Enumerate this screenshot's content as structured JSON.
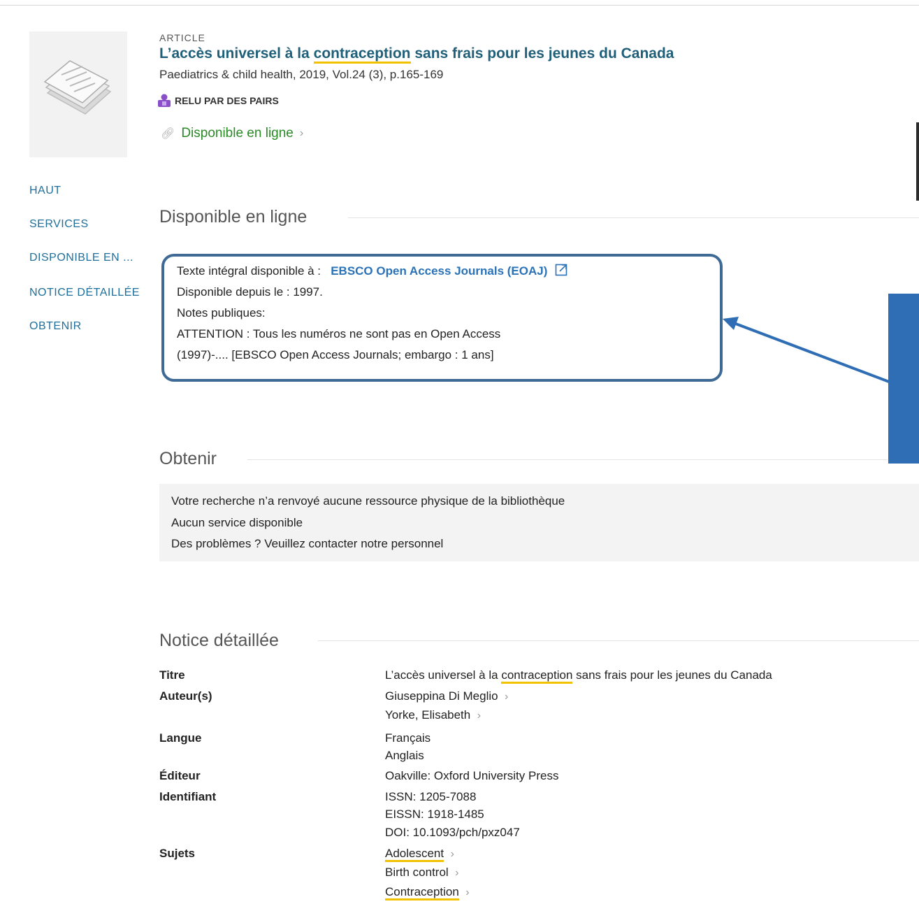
{
  "record": {
    "type": "ARTICLE",
    "title_before": "L’accès universel à la ",
    "title_highlight": "contraception",
    "title_after": " sans frais pour les jeunes du Canada",
    "source": "Paediatrics & child health, 2019, Vol.24 (3), p.165-169",
    "peer_reviewed": "RELU PAR DES PAIRS",
    "availability": "Disponible en ligne"
  },
  "nav": {
    "items": [
      {
        "label": "HAUT"
      },
      {
        "label": "SERVICES"
      },
      {
        "label": "DISPONIBLE EN ..."
      },
      {
        "label": "NOTICE DÉTAILLÉE"
      },
      {
        "label": "OBTENIR"
      }
    ]
  },
  "online": {
    "heading": "Disponible en ligne",
    "fulltext_label": "Texte intégral disponible à :",
    "provider": "EBSCO Open Access Journals (EOAJ)",
    "since": "Disponible depuis le : 1997.",
    "notes_label": "Notes publiques:",
    "note1": "ATTENTION : Tous les numéros ne sont pas en Open Access",
    "note2": "(1997)-.... [EBSCO Open Access Journals; embargo : 1 ans]"
  },
  "obtain": {
    "heading": "Obtenir",
    "line1": "Votre recherche n’a renvoyé aucune ressource physique de la bibliothèque",
    "line2": "Aucun service disponible",
    "line3": "Des problèmes ? Veuillez contacter notre personnel"
  },
  "details": {
    "heading": "Notice détaillée",
    "title_label": "Titre",
    "title_before": "L’accès universel à la ",
    "title_highlight": "contraception",
    "title_after": " sans frais pour les jeunes du Canada",
    "authors_label": "Auteur(s)",
    "authors": [
      "Giuseppina Di Meglio",
      "Yorke, Elisabeth"
    ],
    "language_label": "Langue",
    "languages": [
      "Français",
      "Anglais"
    ],
    "publisher_label": "Éditeur",
    "publisher": "Oakville: Oxford University Press",
    "identifier_label": "Identifiant",
    "identifiers": [
      "ISSN: 1205-7088",
      "EISSN: 1918-1485",
      "DOI: 10.1093/pch/pxz047"
    ],
    "subjects_label": "Sujets",
    "subjects": [
      "Adolescent",
      "Birth control",
      "Contraception"
    ]
  },
  "colors": {
    "link_blue": "#1f6f9a",
    "available_green": "#2a8a26",
    "highlight_yellow": "#f2c200",
    "annotation_blue": "#2f6db4"
  }
}
